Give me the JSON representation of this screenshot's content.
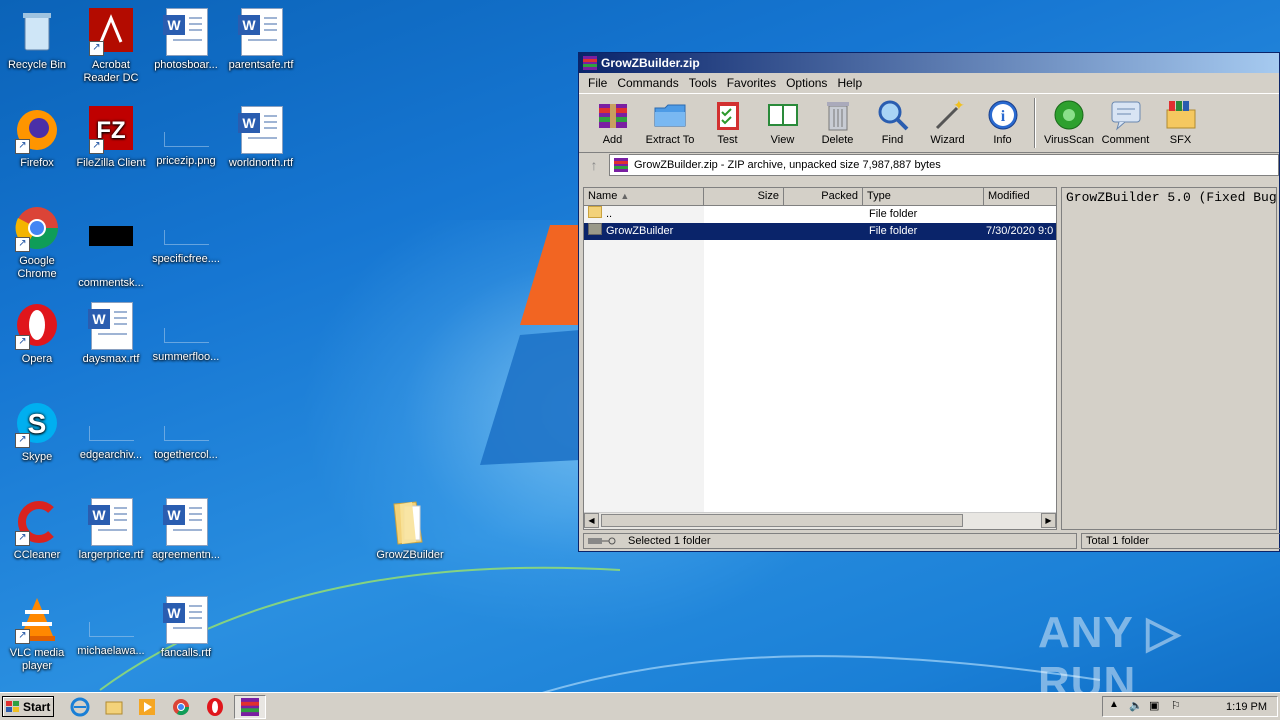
{
  "desktop": {
    "icons": [
      {
        "label": "Recycle Bin"
      },
      {
        "label": "Acrobat Reader DC"
      },
      {
        "label": "photosboar..."
      },
      {
        "label": "parentsafe.rtf"
      },
      {
        "label": "Firefox"
      },
      {
        "label": "FileZilla Client"
      },
      {
        "label": "pricezip.png"
      },
      {
        "label": "worldnorth.rtf"
      },
      {
        "label": "Google Chrome"
      },
      {
        "label": "commentsk..."
      },
      {
        "label": "specificfree...."
      },
      {
        "label": "Opera"
      },
      {
        "label": "daysmax.rtf"
      },
      {
        "label": "summerfloo..."
      },
      {
        "label": "Skype"
      },
      {
        "label": "edgearchiv..."
      },
      {
        "label": "togethercol..."
      },
      {
        "label": "CCleaner"
      },
      {
        "label": "largerprice.rtf"
      },
      {
        "label": "agreementn..."
      },
      {
        "label": "GrowZBuilder"
      },
      {
        "label": "VLC media player"
      },
      {
        "label": "michaelawa..."
      },
      {
        "label": "fancalls.rtf"
      }
    ]
  },
  "window": {
    "title": "GrowZBuilder.zip",
    "menu": [
      "File",
      "Commands",
      "Tools",
      "Favorites",
      "Options",
      "Help"
    ],
    "toolbar": [
      "Add",
      "Extract To",
      "Test",
      "View",
      "Delete",
      "Find",
      "Wizard",
      "Info",
      "VirusScan",
      "Comment",
      "SFX"
    ],
    "address": "GrowZBuilder.zip - ZIP archive, unpacked size 7,987,887 bytes",
    "columns": [
      "Name",
      "Size",
      "Packed",
      "Type",
      "Modified"
    ],
    "rows": [
      {
        "name": "..",
        "size": "",
        "packed": "",
        "type": "File folder",
        "modified": ""
      },
      {
        "name": "GrowZBuilder",
        "size": "",
        "packed": "",
        "type": "File folder",
        "modified": "7/30/2020 9:0"
      }
    ],
    "comment_text": "GrowZBuilder 5.0 (Fixed Bug",
    "status_left": "Selected 1 folder",
    "status_right": "Total 1 folder"
  },
  "taskbar": {
    "start_label": "Start",
    "clock": "1:19 PM"
  },
  "watermark": "ANY ▷ RUN",
  "colors": {
    "title_bar": "#0a246a",
    "selection": "#0a246a",
    "desktop": "#1676d2"
  }
}
